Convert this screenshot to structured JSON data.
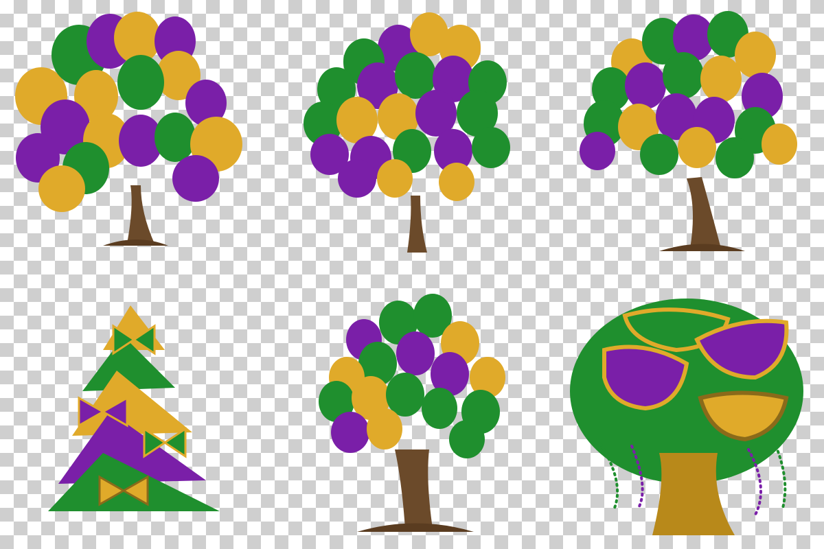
{
  "canvas": {
    "background": "transparency-checkerboard"
  },
  "palette": {
    "purple": "#7a1fa8",
    "green": "#1f8f2e",
    "gold": "#e0aa2a",
    "trunk": "#6b4a2a"
  },
  "illustrations": [
    {
      "name": "balloon-tree-1",
      "kind": "balloon tree"
    },
    {
      "name": "balloon-tree-2",
      "kind": "balloon tree"
    },
    {
      "name": "balloon-tree-3",
      "kind": "balloon tree"
    },
    {
      "name": "christmas-tree-bows",
      "kind": "bow christmas tree"
    },
    {
      "name": "balloon-tree-4",
      "kind": "balloon tree"
    },
    {
      "name": "mask-tree",
      "kind": "carnival mask tree with beads"
    }
  ]
}
